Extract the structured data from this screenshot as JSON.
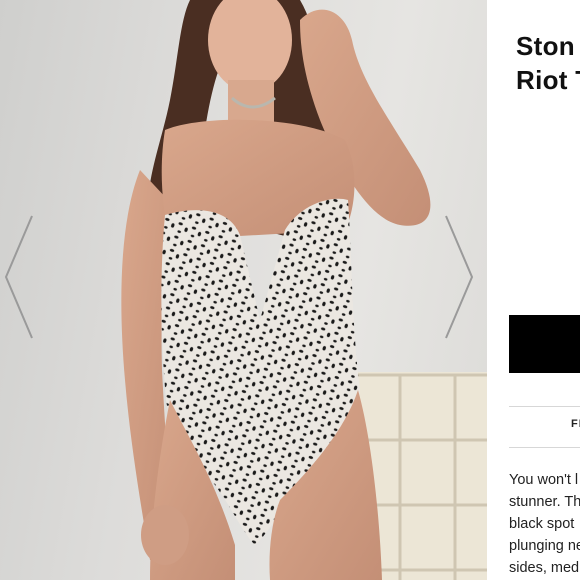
{
  "product": {
    "title_lines": [
      "Ston",
      "Riot T"
    ],
    "add_button_label": "",
    "details_tab_label": "FI",
    "description_lines": [
      "You won't l",
      "stunner. Th",
      "black spot",
      "plunging ne",
      "sides, med"
    ]
  },
  "gallery": {
    "image_subject": "model-in-spotted-bodysuit",
    "icons": {
      "prev": "chevron-left-icon",
      "next": "chevron-right-icon"
    }
  },
  "colors": {
    "button": "#000000",
    "text": "#111111",
    "arrow": "#9a9a9a"
  }
}
